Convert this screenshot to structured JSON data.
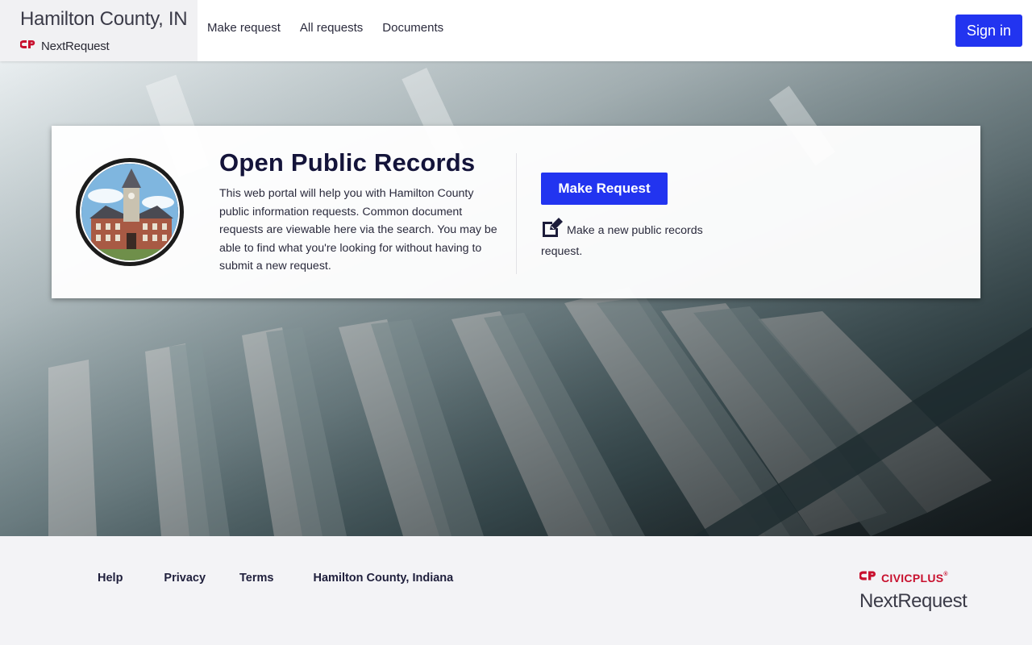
{
  "header": {
    "org_title": "Hamilton County, IN",
    "brand_name": "NextRequest",
    "nav": [
      {
        "label": "Make request"
      },
      {
        "label": "All requests"
      },
      {
        "label": "Documents"
      }
    ],
    "signin_label": "Sign in"
  },
  "card": {
    "title": "Open Public Records",
    "description": "This web portal will help you with Hamilton County public information requests. Common document requests are viewable here via the search. You may be able to find what you're looking for without having to submit a new request.",
    "button_label": "Make Request",
    "new_request_text": "Make a new public records request."
  },
  "footer": {
    "links": [
      {
        "label": "Help"
      },
      {
        "label": "Privacy"
      },
      {
        "label": "Terms"
      },
      {
        "label": "Hamilton County, Indiana"
      }
    ],
    "civic_brand": "CIVICPLUS",
    "civic_tm": "®",
    "product_name": "NextRequest"
  },
  "icons": {
    "brand_logo": "cp-logo-icon",
    "seal": "county-courthouse-seal",
    "edit": "edit-icon"
  },
  "colors": {
    "primary": "#2234f0",
    "civic_red": "#c8102e",
    "title_dark": "#14143a"
  }
}
